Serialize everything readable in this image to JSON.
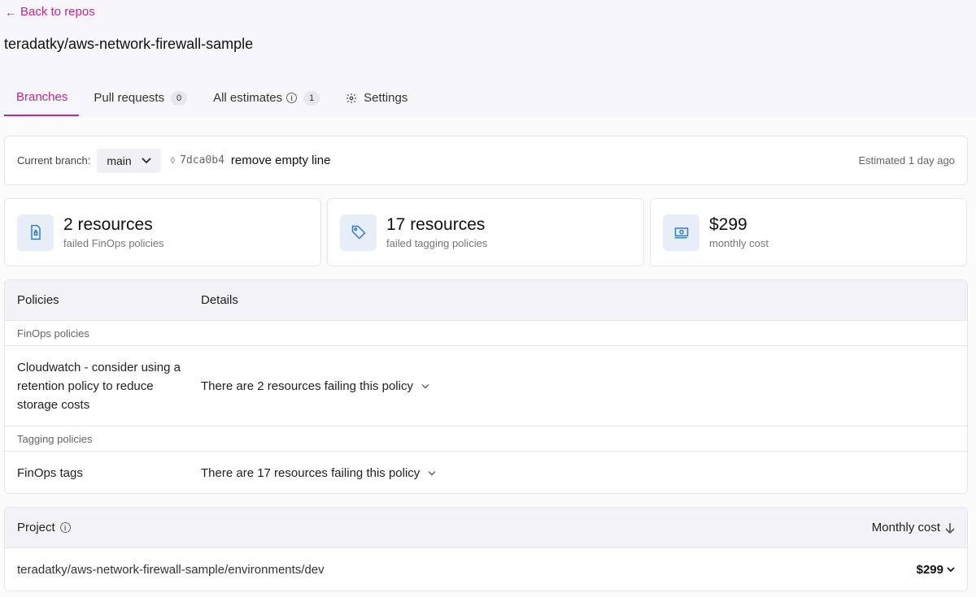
{
  "nav": {
    "back_label": "Back to repos",
    "back_icon": "arrow-left-icon"
  },
  "repo": {
    "title": "teradatky/aws-network-firewall-sample"
  },
  "tabs": [
    {
      "label": "Branches",
      "active": true
    },
    {
      "label": "Pull requests",
      "badge": "0"
    },
    {
      "label": "All estimates",
      "badge": "1"
    },
    {
      "label": "Settings",
      "icon": "gear-icon"
    }
  ],
  "branch": {
    "label": "Current branch:",
    "selected": "main",
    "commit_hash": "7dca0b4",
    "commit_message": "remove empty line",
    "estimated": "Estimated 1 day ago"
  },
  "stats": [
    {
      "value": "2 resources",
      "sub": "failed FinOps policies",
      "icon": "file-lock-icon"
    },
    {
      "value": "17 resources",
      "sub": "failed tagging policies",
      "icon": "tag-icon"
    },
    {
      "value": "$299",
      "sub": "monthly cost",
      "icon": "money-icon"
    }
  ],
  "policies": {
    "header": {
      "col1": "Policies",
      "col2": "Details"
    },
    "sections": [
      {
        "title": "FinOps policies",
        "rows": [
          {
            "name": "Cloudwatch - consider using a retention policy to reduce storage costs",
            "detail": "There are 2 resources failing this policy"
          }
        ]
      },
      {
        "title": "Tagging policies",
        "rows": [
          {
            "name": "FinOps tags",
            "detail": "There are 17 resources failing this policy"
          }
        ]
      }
    ]
  },
  "projects": {
    "header": {
      "label": "Project",
      "cost_label": "Monthly cost"
    },
    "rows": [
      {
        "path": "teradatky/aws-network-firewall-sample/environments/dev",
        "cost": "$299"
      }
    ]
  },
  "colors": {
    "accent": "#c0268e",
    "icon_bg": "#e7eef8",
    "icon_fg": "#2f80c8"
  }
}
